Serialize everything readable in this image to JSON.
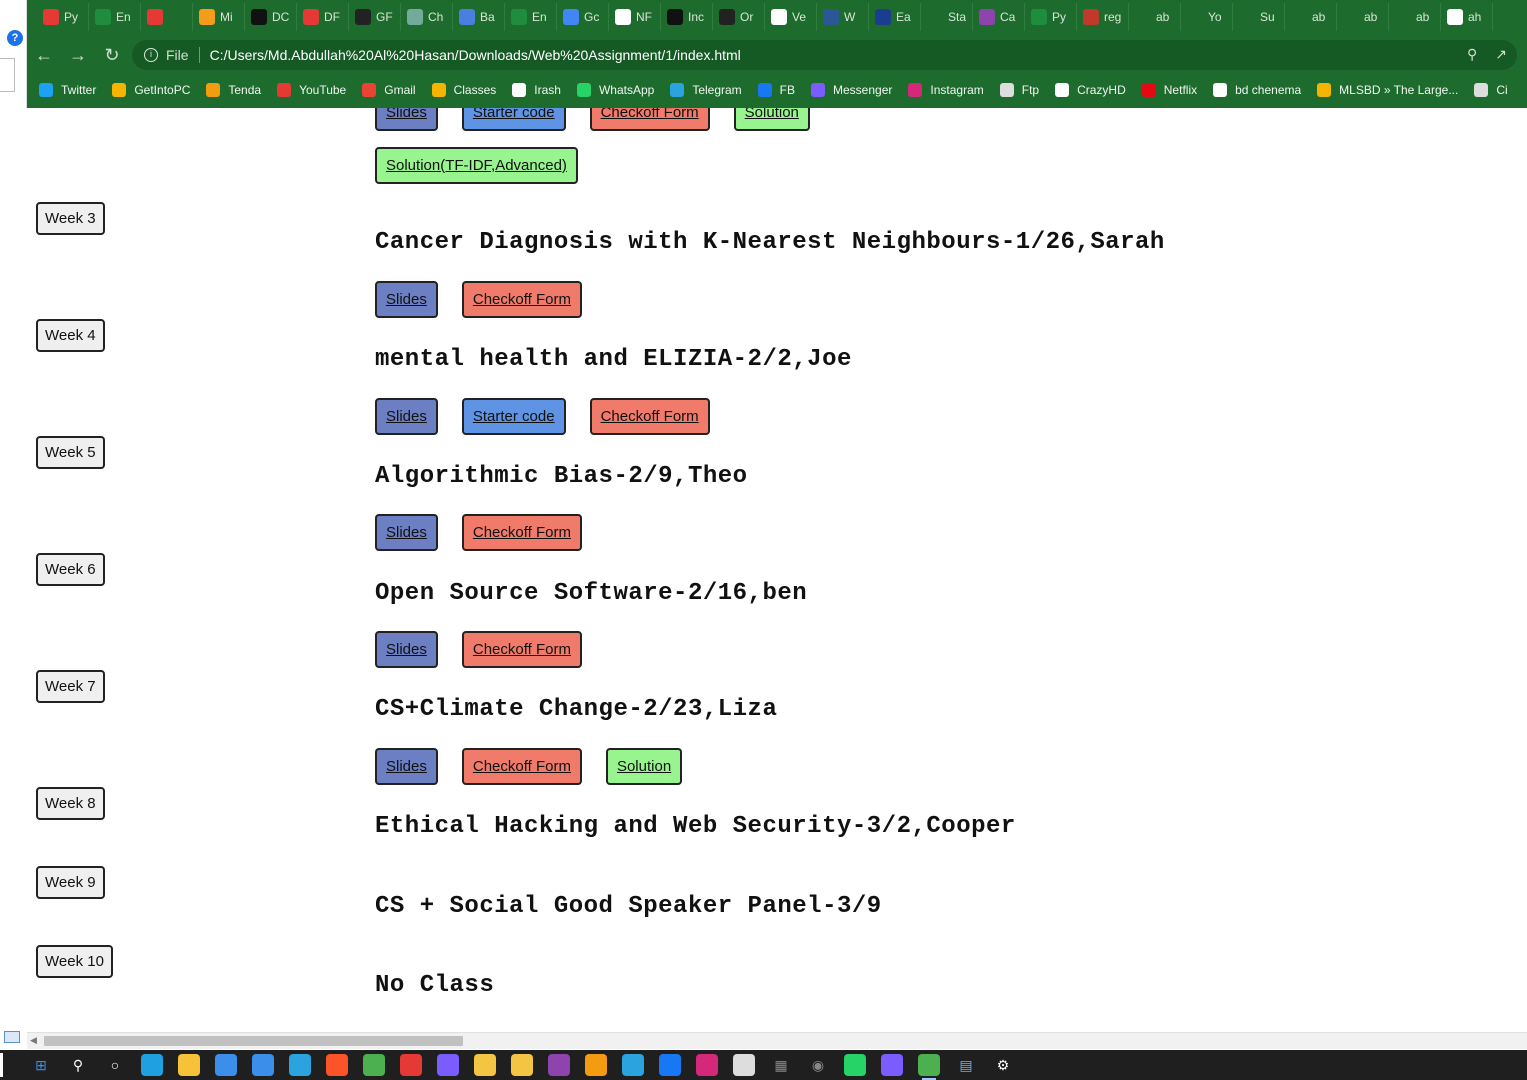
{
  "browser": {
    "tabs": [
      {
        "label": "Py",
        "icon": "youtube-icon",
        "color": "#e53935"
      },
      {
        "label": "En",
        "icon": "sheets-icon",
        "color": "#1e8e3e"
      },
      {
        "label": "",
        "icon": "youtube-audio-icon",
        "color": "#e53935"
      },
      {
        "label": "Mi",
        "icon": "mi-icon",
        "color": "#f59c1a"
      },
      {
        "label": "DC",
        "icon": "dc-icon",
        "color": "#111111"
      },
      {
        "label": "DF",
        "icon": "play-icon",
        "color": "#e53935"
      },
      {
        "label": "GF",
        "icon": "chatgpt-icon",
        "color": "#222222"
      },
      {
        "label": "Ch",
        "icon": "chatgpt-icon",
        "color": "#74aa9c"
      },
      {
        "label": "Ba",
        "icon": "bard-icon",
        "color": "#4a7fe0"
      },
      {
        "label": "En",
        "icon": "sheets-icon",
        "color": "#1e8e3e"
      },
      {
        "label": "Gc",
        "icon": "translate-icon",
        "color": "#4285f4"
      },
      {
        "label": "NF",
        "icon": "google-icon",
        "color": "#ffffff"
      },
      {
        "label": "Inc",
        "icon": "a-icon",
        "color": "#111111"
      },
      {
        "label": "Or",
        "icon": "or-icon",
        "color": "#222222"
      },
      {
        "label": "Ve",
        "icon": "google-icon",
        "color": "#ffffff"
      },
      {
        "label": "W",
        "icon": "w-icon",
        "color": "#2b5797"
      },
      {
        "label": "Ea",
        "icon": "ewu-icon",
        "color": "#1a3d8f"
      },
      {
        "label": "Sta",
        "icon": "sta-icon",
        "color": "#1e6b2e"
      },
      {
        "label": "Ca",
        "icon": "canva-icon",
        "color": "#8e44ad"
      },
      {
        "label": "Py",
        "icon": "w-green-icon",
        "color": "#1e8e3e"
      },
      {
        "label": "reg",
        "icon": "reg-icon",
        "color": "#c0392b"
      },
      {
        "label": "ab",
        "icon": "github-icon",
        "color": "#1e6b2e"
      },
      {
        "label": "Yo",
        "icon": "github-icon",
        "color": "#1e6b2e"
      },
      {
        "label": "Su",
        "icon": "github-icon",
        "color": "#1e6b2e"
      },
      {
        "label": "ab",
        "icon": "github-icon",
        "color": "#1e6b2e"
      },
      {
        "label": "ab",
        "icon": "github-icon",
        "color": "#1e6b2e"
      },
      {
        "label": "ab",
        "icon": "github-icon",
        "color": "#1e6b2e"
      },
      {
        "label": "ah",
        "icon": "google-icon",
        "color": "#ffffff"
      }
    ],
    "file_label": "File",
    "url": "C:/Users/Md.Abdullah%20Al%20Hasan/Downloads/Web%20Assignment/1/index.html",
    "bookmarks": [
      {
        "label": "Twitter",
        "icon": "twitter-icon",
        "color": "#1da1f2"
      },
      {
        "label": "GetIntoPC",
        "icon": "getintopc-icon",
        "color": "#f5b400"
      },
      {
        "label": "Tenda",
        "icon": "tenda-icon",
        "color": "#f39c12"
      },
      {
        "label": "YouTube",
        "icon": "youtube-icon",
        "color": "#e53935"
      },
      {
        "label": "Gmail",
        "icon": "gmail-icon",
        "color": "#ea4335"
      },
      {
        "label": "Classes",
        "icon": "classroom-icon",
        "color": "#f4b400"
      },
      {
        "label": "Irash",
        "icon": "irash-icon",
        "color": "#ffffff"
      },
      {
        "label": "WhatsApp",
        "icon": "whatsapp-icon",
        "color": "#25d366"
      },
      {
        "label": "Telegram",
        "icon": "telegram-icon",
        "color": "#2aa3df"
      },
      {
        "label": "FB",
        "icon": "facebook-icon",
        "color": "#1877f2"
      },
      {
        "label": "Messenger",
        "icon": "messenger-icon",
        "color": "#7b5cff"
      },
      {
        "label": "Instagram",
        "icon": "instagram-icon",
        "color": "#d6287a"
      },
      {
        "label": "Ftp",
        "icon": "ftp-icon",
        "color": "#dddddd"
      },
      {
        "label": "CrazyHD",
        "icon": "crazyhd-icon",
        "color": "#ffffff"
      },
      {
        "label": "Netflix",
        "icon": "netflix-icon",
        "color": "#e50914"
      },
      {
        "label": "bd chenema",
        "icon": "globe-icon",
        "color": "#ffffff"
      },
      {
        "label": "MLSBD » The Large...",
        "icon": "mlsbd-icon",
        "color": "#f5b400"
      },
      {
        "label": "Ci",
        "icon": "ci-icon",
        "color": "#dddddd"
      }
    ]
  },
  "colors": {
    "slides": "#6b7fc2",
    "starter": "#5f94e4",
    "checkoff": "#f07b6a",
    "solution": "#98f48e"
  },
  "page": {
    "top_partial_buttons": [
      "Slides",
      "Starter code",
      "Checkoff Form",
      "Solution"
    ],
    "extra_solution_button": "Solution(TF-IDF,Advanced)",
    "weeks": [
      {
        "label": "Week 3",
        "topic": "Cancer Diagnosis with K-Nearest Neighbours-1/26,Sarah",
        "buttons": [
          "Slides",
          "Checkoff Form"
        ]
      },
      {
        "label": "Week 4",
        "topic": "mental health and ELIZIA-2/2,Joe",
        "buttons": [
          "Slides",
          "Starter code",
          "Checkoff Form"
        ]
      },
      {
        "label": "Week 5",
        "topic": "Algorithmic Bias-2/9,Theo",
        "buttons": [
          "Slides",
          "Checkoff Form"
        ]
      },
      {
        "label": "Week 6",
        "topic": "Open Source Software-2/16,ben",
        "buttons": [
          "Slides",
          "Checkoff Form"
        ]
      },
      {
        "label": "Week 7",
        "topic": "CS+Climate Change-2/23,Liza",
        "buttons": [
          "Slides",
          "Checkoff Form",
          "Solution"
        ]
      },
      {
        "label": "Week 8",
        "topic": "Ethical Hacking and Web Security-3/2,Cooper",
        "buttons": []
      },
      {
        "label": "Week 9",
        "topic": "CS + Social Good Speaker Panel-3/9",
        "buttons": []
      },
      {
        "label": "Week 10",
        "topic": "No Class",
        "buttons": []
      }
    ]
  },
  "taskbar": {
    "apps": [
      {
        "icon": "windows-start-icon",
        "color": "#3b8eea"
      },
      {
        "icon": "search-icon",
        "color": "#ffffff"
      },
      {
        "icon": "cortana-icon",
        "color": "#ffffff"
      },
      {
        "icon": "edge-icon",
        "color": "#1fa0e0"
      },
      {
        "icon": "file-explorer-icon",
        "color": "#f5c23a"
      },
      {
        "icon": "store-icon",
        "color": "#3b8eea"
      },
      {
        "icon": "mail-icon",
        "color": "#3b8eea"
      },
      {
        "icon": "ccleaner-icon",
        "color": "#2aa3df"
      },
      {
        "icon": "brave-icon",
        "color": "#fb542b"
      },
      {
        "icon": "chrome-icon",
        "color": "#4caf50"
      },
      {
        "icon": "app-red-icon",
        "color": "#e53935"
      },
      {
        "icon": "github-desktop-icon",
        "color": "#7b5cff"
      },
      {
        "icon": "app-diamond-icon",
        "color": "#f4c542"
      },
      {
        "icon": "app-yellow-icon",
        "color": "#f4c542"
      },
      {
        "icon": "visual-studio-icon",
        "color": "#8e44ad"
      },
      {
        "icon": "app-orange-icon",
        "color": "#f39c12"
      },
      {
        "icon": "vscode-icon",
        "color": "#2aa3df"
      },
      {
        "icon": "facebook-icon",
        "color": "#1877f2"
      },
      {
        "icon": "instagram-icon",
        "color": "#d6287a"
      },
      {
        "icon": "app-unity-icon",
        "color": "#dddddd"
      },
      {
        "icon": "calculator-icon",
        "color": "#888888"
      },
      {
        "icon": "camera-icon",
        "color": "#888888"
      },
      {
        "icon": "whatsapp-icon",
        "color": "#25d366"
      },
      {
        "icon": "app-circle-icon",
        "color": "#7b5cff"
      },
      {
        "icon": "chrome-active-icon",
        "color": "#4caf50"
      },
      {
        "icon": "notepad-icon",
        "color": "#66b3ff"
      },
      {
        "icon": "settings-icon",
        "color": "#ffffff"
      }
    ]
  }
}
